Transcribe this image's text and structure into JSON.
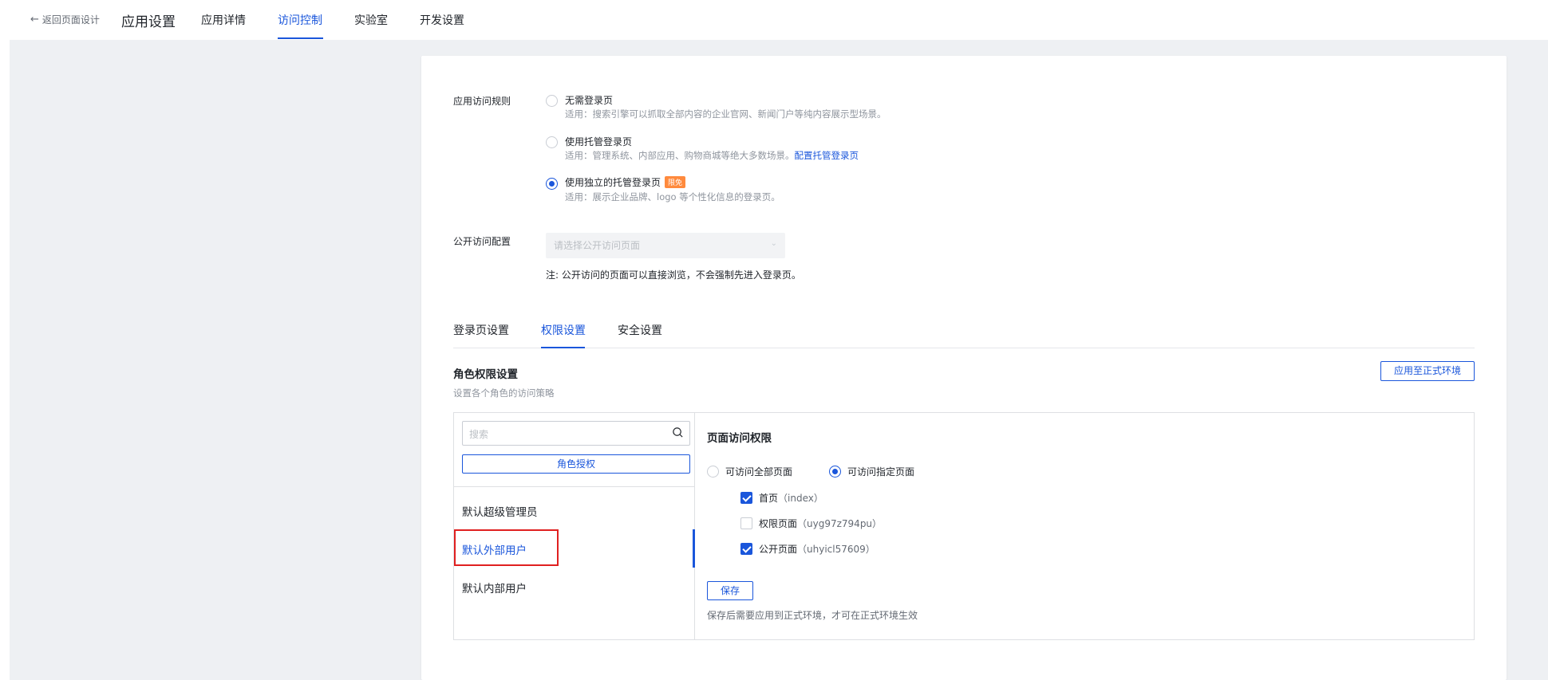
{
  "header": {
    "back_label": "返回页面设计",
    "app_title": "应用设置",
    "tabs": [
      "应用详情",
      "访问控制",
      "实验室",
      "开发设置"
    ],
    "active_tab": "访问控制"
  },
  "access_rule": {
    "label": "应用访问规则",
    "options": [
      {
        "title": "无需登录页",
        "desc": "适用：搜索引擎可以抓取全部内容的企业官网、新闻门户等纯内容展示型场景。",
        "checked": false
      },
      {
        "title": "使用托管登录页",
        "desc": "适用：管理系统、内部应用、购物商城等绝大多数场景。",
        "link": "配置托管登录页",
        "checked": false
      },
      {
        "title": "使用独立的托管登录页",
        "badge": "限免",
        "desc": "适用：展示企业品牌、logo 等个性化信息的登录页。",
        "checked": true
      }
    ]
  },
  "public_access": {
    "label": "公开访问配置",
    "placeholder": "请选择公开访问页面",
    "note": "注: 公开访问的页面可以直接浏览，不会强制先进入登录页。"
  },
  "sub_tabs": [
    "登录页设置",
    "权限设置",
    "安全设置"
  ],
  "active_sub_tab": "权限设置",
  "role_section": {
    "title": "角色权限设置",
    "desc": "设置各个角色的访问策略",
    "apply_button": "应用至正式环境"
  },
  "roles_panel": {
    "search_placeholder": "搜索",
    "authorize_button": "角色授权",
    "roles": [
      "默认超级管理员",
      "默认外部用户",
      "默认内部用户"
    ],
    "active_role": "默认外部用户"
  },
  "page_access": {
    "title": "页面访问权限",
    "modes": [
      {
        "label": "可访问全部页面",
        "checked": false
      },
      {
        "label": "可访问指定页面",
        "checked": true
      }
    ],
    "pages": [
      {
        "name": "首页",
        "code": "（index）",
        "checked": true
      },
      {
        "name": "权限页面",
        "code": "（uyg97z794pu）",
        "checked": false
      },
      {
        "name": "公开页面",
        "code": "（uhyicl57609）",
        "checked": true
      }
    ],
    "save_button": "保存",
    "save_hint": "保存后需要应用到正式环境，才可在正式环境生效"
  },
  "colors": {
    "accent": "#1a56db",
    "highlight": "#e02020",
    "badge": "#ff8a3d"
  }
}
